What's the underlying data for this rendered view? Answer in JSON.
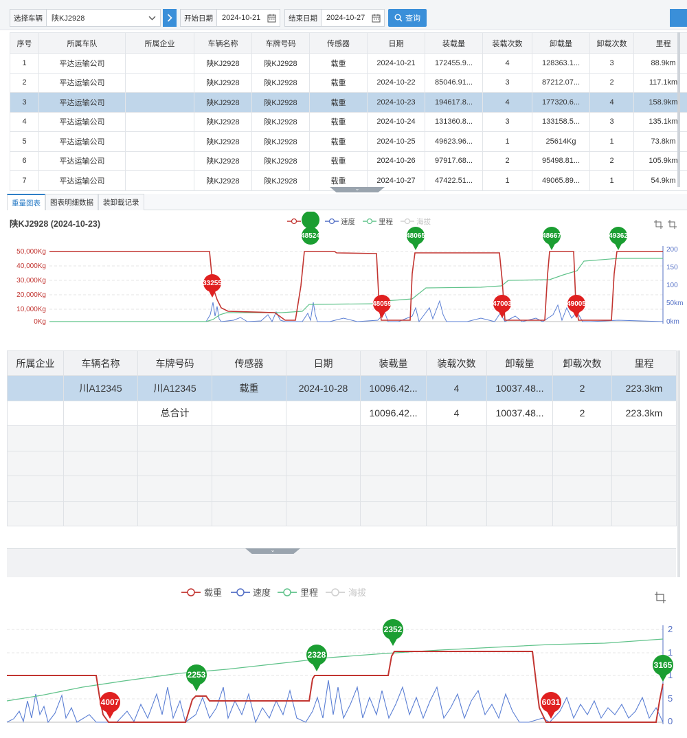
{
  "toolbar": {
    "vehicle_label": "选择车辆",
    "vehicle_value": "陕KJ2928",
    "start_label": "开始日期",
    "start_value": "2024-10-21",
    "end_label": "结束日期",
    "end_value": "2024-10-27",
    "query_label": "查询"
  },
  "top_table": {
    "headers": [
      "序号",
      "所属车队",
      "所属企业",
      "车辆名称",
      "车牌号码",
      "传感器",
      "日期",
      "装载量",
      "装载次数",
      "卸载量",
      "卸载次数",
      "里程"
    ],
    "rows": [
      [
        "1",
        "平达运输公司",
        "",
        "陕KJ2928",
        "陕KJ2928",
        "载重",
        "2024-10-21",
        "172455.9...",
        "4",
        "128363.1...",
        "3",
        "88.9km"
      ],
      [
        "2",
        "平达运输公司",
        "",
        "陕KJ2928",
        "陕KJ2928",
        "载重",
        "2024-10-22",
        "85046.91...",
        "3",
        "87212.07...",
        "2",
        "117.1km"
      ],
      [
        "3",
        "平达运输公司",
        "",
        "陕KJ2928",
        "陕KJ2928",
        "载重",
        "2024-10-23",
        "194617.8...",
        "4",
        "177320.6...",
        "4",
        "158.9km"
      ],
      [
        "4",
        "平达运输公司",
        "",
        "陕KJ2928",
        "陕KJ2928",
        "载重",
        "2024-10-24",
        "131360.8...",
        "3",
        "133158.5...",
        "3",
        "135.1km"
      ],
      [
        "5",
        "平达运输公司",
        "",
        "陕KJ2928",
        "陕KJ2928",
        "载重",
        "2024-10-25",
        "49623.96...",
        "1",
        "25614Kg",
        "1",
        "73.8km"
      ],
      [
        "6",
        "平达运输公司",
        "",
        "陕KJ2928",
        "陕KJ2928",
        "载重",
        "2024-10-26",
        "97917.68...",
        "2",
        "95498.81...",
        "2",
        "105.9km"
      ],
      [
        "7",
        "平达运输公司",
        "",
        "陕KJ2928",
        "陕KJ2928",
        "载重",
        "2024-10-27",
        "47422.51...",
        "1",
        "49065.89...",
        "1",
        "54.9km"
      ]
    ],
    "selected_index": 2
  },
  "tabs": [
    "重量图表",
    "图表明细数据",
    "装卸载记录"
  ],
  "chart1": {
    "title": "陕KJ2928 (2024-10-23)",
    "legend": [
      {
        "name": "载重",
        "color": "#c23531"
      },
      {
        "name": "速度",
        "color": "#5470c6"
      },
      {
        "name": "里程",
        "color": "#61c38b"
      },
      {
        "name": "海拔",
        "color": "#d0d0d0"
      }
    ],
    "y_left_ticks": [
      "50,000Kg",
      "40,000Kg",
      "30,000Kg",
      "20,000Kg",
      "10,000Kg",
      "0Kg"
    ],
    "y_right_ticks": [
      "200",
      "150",
      "100",
      "50km",
      "0km"
    ],
    "load_markers": [
      "48524",
      "48065",
      "48667",
      "49362"
    ],
    "unload_markers": [
      "33255",
      "48059",
      "47003",
      "49005"
    ]
  },
  "bottom_table": {
    "headers": [
      "所属企业",
      "车辆名称",
      "车牌号码",
      "传感器",
      "日期",
      "装载量",
      "装载次数",
      "卸载量",
      "卸载次数",
      "里程"
    ],
    "rows": [
      [
        "",
        "川A12345",
        "川A12345",
        "载重",
        "2024-10-28",
        "10096.42...",
        "4",
        "10037.48...",
        "2",
        "223.3km"
      ],
      [
        "",
        "",
        "总合计",
        "",
        "",
        "10096.42...",
        "4",
        "10037.48...",
        "2",
        "223.3km"
      ]
    ]
  },
  "chart2": {
    "legend": [
      {
        "name": "载重",
        "color": "#c23531"
      },
      {
        "name": "速度",
        "color": "#5470c6"
      },
      {
        "name": "里程",
        "color": "#61c38b"
      },
      {
        "name": "海拔",
        "color": "#d0d0d0"
      }
    ],
    "y_right_ticks": [
      "2",
      "1",
      "1",
      "5",
      "0"
    ],
    "load_markers": [
      "2253",
      "2328",
      "2352",
      "3165"
    ],
    "unload_markers": [
      "4007",
      "6031"
    ]
  }
}
